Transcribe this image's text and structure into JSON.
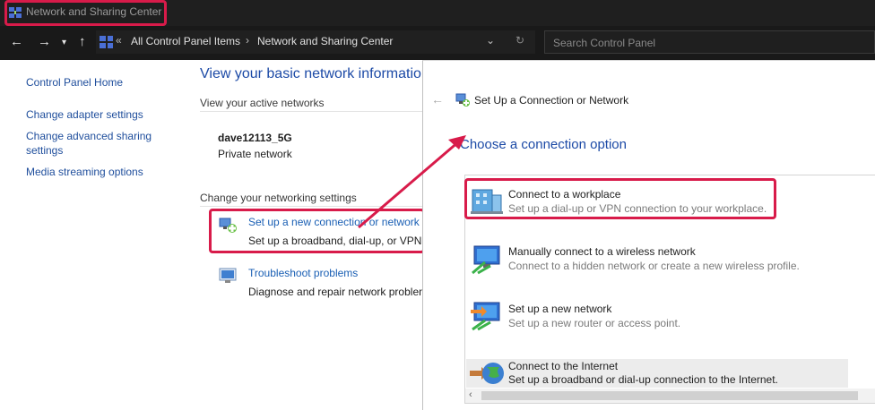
{
  "window": {
    "title": "Network and Sharing Center"
  },
  "addressbar": {
    "breadcrumbs": [
      "All Control Panel Items",
      "Network and Sharing Center"
    ],
    "overflow": "«",
    "search_placeholder": "Search Control Panel"
  },
  "sidebar": {
    "items": [
      {
        "label": "Control Panel Home"
      },
      {
        "label": "Change adapter settings"
      },
      {
        "label": "Change advanced sharing settings"
      },
      {
        "label": "Media streaming options"
      }
    ]
  },
  "main": {
    "heading": "View your basic network information",
    "active_networks_label": "View your active networks",
    "network_name": "dave12113_5G",
    "network_type": "Private network",
    "change_settings_label": "Change your networking settings",
    "tasks": [
      {
        "link": "Set up a new connection or network",
        "desc": "Set up a broadband, dial-up, or VPN"
      },
      {
        "link": "Troubleshoot problems",
        "desc": "Diagnose and repair network problems"
      }
    ]
  },
  "dialog": {
    "back_icon": "back-arrow-icon",
    "title": "Set Up a Connection or Network",
    "heading": "Choose a connection option",
    "options": [
      {
        "title": "Connect to a workplace",
        "desc": "Set up a dial-up or VPN connection to your workplace.",
        "icon": "building-icon"
      },
      {
        "title": "Manually connect to a wireless network",
        "desc": "Connect to a hidden network or create a new wireless profile.",
        "icon": "wireless-monitor-icon"
      },
      {
        "title": "Set up a new network",
        "desc": "Set up a new router or access point.",
        "icon": "router-monitor-icon"
      },
      {
        "title": "Connect to the Internet",
        "desc": "Set up a broadband or dial-up connection to the Internet.",
        "icon": "globe-icon"
      }
    ]
  },
  "colors": {
    "highlight": "#d81b4a",
    "link": "#1a5fb4",
    "heading": "#1c4aa6",
    "titlebar": "#1f1f1f"
  }
}
